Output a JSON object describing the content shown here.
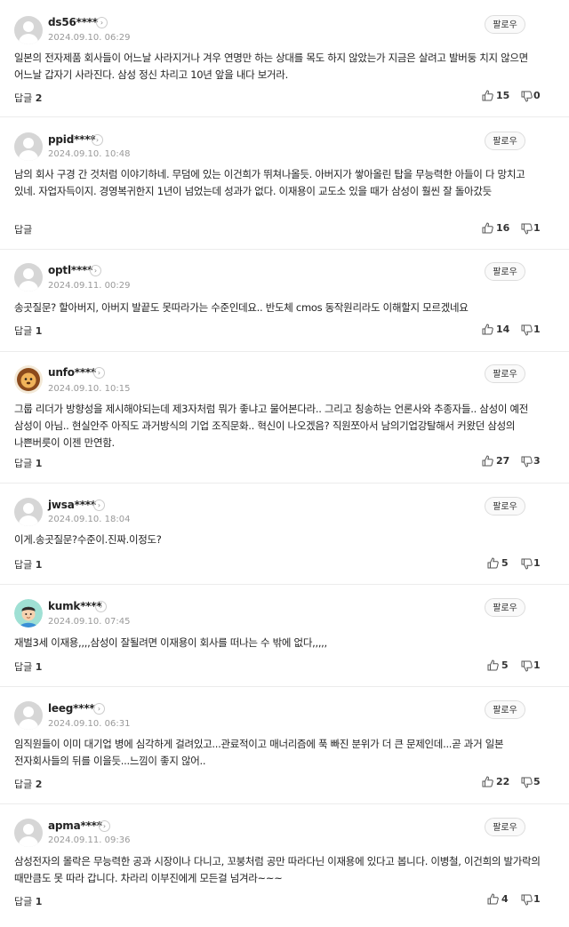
{
  "labels": {
    "follow": "팔로우",
    "reply": "답글"
  },
  "colors": {
    "text": "#222222",
    "meta": "#999999",
    "divider": "#ececec",
    "button_border": "#dddddd"
  },
  "comments": [
    {
      "nickname": "ds56****",
      "date": "2024.09.10. 06:29",
      "avatar": "default-avatar",
      "text": "일본의 전자제품 회사들이 어느날 사라지거나 겨우 연명만 하는 상대를 목도 하지 않았는가 지금은 살려고 발버둥 치지 않으면 어느날 갑자기 사라진다. 삼성 정신 차리고 10년 앞을 내다 보거라.",
      "replies": "2",
      "likes": "15",
      "dislikes": "0"
    },
    {
      "nickname": "ppid****",
      "date": "2024.09.10. 10:48",
      "avatar": "default-avatar",
      "text": "남의 회사 구경 간 것처럼 이야기하네. 무덤에 있는 이건희가 뛰쳐나올듯. 아버지가 쌓아올린 탑을 무능력한 아들이 다 망치고 있네. 자업자득이지. 경영복귀한지 1년이 넘었는데 성과가 없다. 이재용이 교도소 있을 때가 삼성이 훨씬 잘 돌아갔듯",
      "replies": "",
      "likes": "16",
      "dislikes": "1"
    },
    {
      "nickname": "optl****",
      "date": "2024.09.11. 00:29",
      "avatar": "default-avatar",
      "text": "송곳질문? 할아버지, 아버지 발끝도 못따라가는 수준인데요.. 반도체 cmos 동작원리라도 이해할지 모르겠네요",
      "replies": "1",
      "likes": "14",
      "dislikes": "1"
    },
    {
      "nickname": "unfo****",
      "date": "2024.09.10. 10:15",
      "avatar": "lion-avatar",
      "text": "그룹 리더가 방향성을 제시해야되는데 제3자처럼 뭐가 좋냐고 물어본다라.. 그리고 칭송하는 언론사와 추종자들.. 삼성이 예전 삼성이 아님.. 현실안주 아직도 과거방식의 기업 조직문화.. 혁신이 나오겠음? 직원쪼아서 남의기업강탈해서 커왔던 삼성의 나쁜버릇이 이젠 만연함.",
      "replies": "1",
      "likes": "27",
      "dislikes": "3"
    },
    {
      "nickname": "jwsa****",
      "date": "2024.09.10. 18:04",
      "avatar": "default-avatar",
      "text": "이게.송곳질문?수준이.진짜.이정도?",
      "replies": "1",
      "likes": "5",
      "dislikes": "1"
    },
    {
      "nickname": "kumk****",
      "date": "2024.09.10. 07:45",
      "avatar": "boy-avatar",
      "text": "재벌3세 이재용,,,,삼성이 잘될려면 이재용이 회사를 떠나는 수 밖에 없다,,,,,",
      "replies": "1",
      "likes": "5",
      "dislikes": "1"
    },
    {
      "nickname": "leeg****",
      "date": "2024.09.10. 06:31",
      "avatar": "default-avatar",
      "text": "임직원들이 이미 대기업 병에 심각하게 걸려있고...관료적이고 매너리즘에 푹 빠진 분위가 더 큰 문제인데...곧 과거 일본 전자회사들의 뒤를 이을듯...느낌이 좋지 않어..",
      "replies": "2",
      "likes": "22",
      "dislikes": "5"
    },
    {
      "nickname": "apma****",
      "date": "2024.09.11. 09:36",
      "avatar": "default-avatar",
      "text": "삼성전자의 몰락은 무능력한 공과 시장이나 다니고, 꼬붕처럼 공만 따라다닌 이재용에 있다고 봅니다. 이병철, 이건희의 발가락의 때만큼도 못 따라 갑니다. 차라리 이부진에게 모든걸 넘겨라~~~",
      "replies": "1",
      "likes": "4",
      "dislikes": "1"
    }
  ]
}
